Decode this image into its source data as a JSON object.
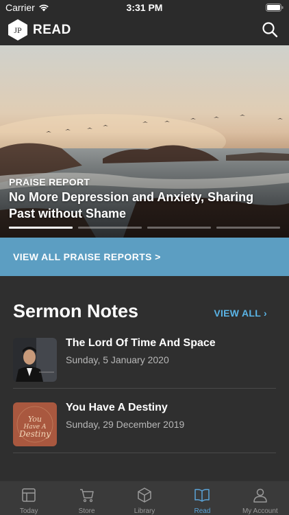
{
  "status_bar": {
    "carrier": "Carrier",
    "time": "3:31 PM"
  },
  "header": {
    "logo_text": "JP",
    "title": "READ"
  },
  "hero": {
    "kicker": "PRAISE REPORT",
    "title": "No More Depression and Anxiety, Sharing Past without Shame",
    "page_count": 4,
    "active_page": 1
  },
  "praise_link": {
    "label": "VIEW ALL PRAISE REPORTS >"
  },
  "sermon_notes": {
    "title": "Sermon Notes",
    "view_all": "VIEW ALL",
    "items": [
      {
        "title": "The Lord Of Time And Space",
        "date": "Sunday, 5 January 2020"
      },
      {
        "title": "You Have A Destiny",
        "date": "Sunday, 29 December 2019",
        "thumb_text": "You Have A Destiny"
      }
    ]
  },
  "tab_bar": {
    "tabs": [
      {
        "label": "Today",
        "icon": "today-icon"
      },
      {
        "label": "Store",
        "icon": "cart-icon"
      },
      {
        "label": "Library",
        "icon": "box-icon"
      },
      {
        "label": "Read",
        "icon": "book-icon"
      },
      {
        "label": "My Account",
        "icon": "person-icon"
      }
    ],
    "active_tab": "Read"
  },
  "colors": {
    "accent_blue": "#5c9ec2",
    "link_blue": "#5ab4e6",
    "tab_active": "#5aa3d8"
  }
}
